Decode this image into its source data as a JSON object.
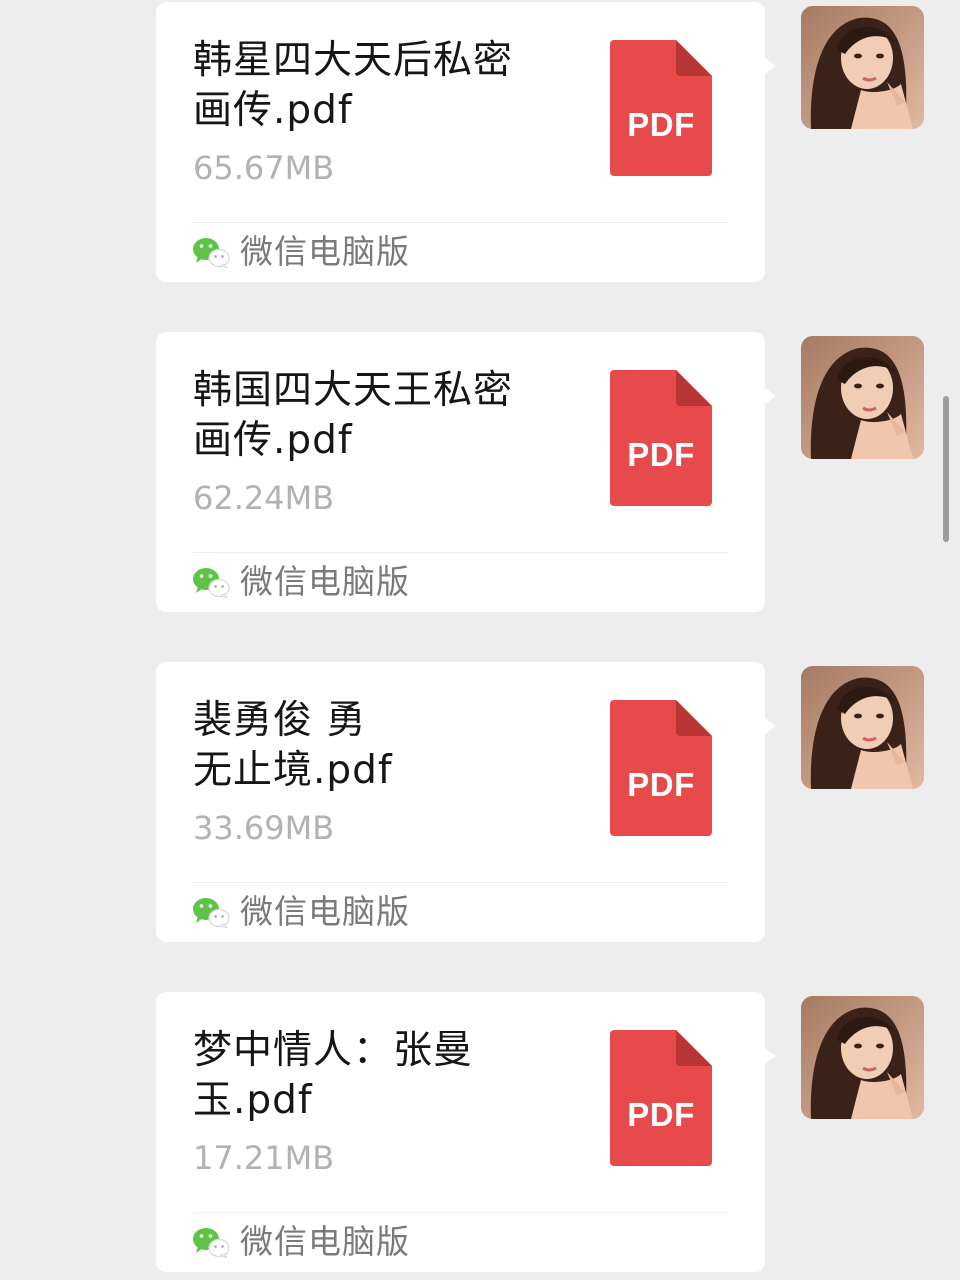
{
  "messages": [
    {
      "file_name_lines": [
        "韩星四大天后私密",
        "画传.pdf"
      ],
      "file_size": "65.67MB",
      "file_type_label": "PDF",
      "source_label": "微信电脑版"
    },
    {
      "file_name_lines": [
        "韩国四大天王私密",
        "画传.pdf"
      ],
      "file_size": "62.24MB",
      "file_type_label": "PDF",
      "source_label": "微信电脑版"
    },
    {
      "file_name_lines": [
        "裴勇俊 勇",
        "无止境.pdf"
      ],
      "file_size": "33.69MB",
      "file_type_label": "PDF",
      "source_label": "微信电脑版"
    },
    {
      "file_name_lines": [
        "梦中情人：张曼",
        "玉.pdf"
      ],
      "file_size": "17.21MB",
      "file_type_label": "PDF",
      "source_label": "微信电脑版"
    }
  ],
  "colors": {
    "background": "#ededed",
    "bubble": "#ffffff",
    "pdf_icon": "#e64a4a",
    "pdf_fold": "#b93434",
    "wechat_green": "#5ec347",
    "file_size_text": "#b2b2b2",
    "source_text": "#7a7a7a"
  },
  "icons": {
    "file_type_icon": "pdf-file-icon",
    "source_icon": "wechat-icon",
    "avatar": "user-avatar"
  }
}
